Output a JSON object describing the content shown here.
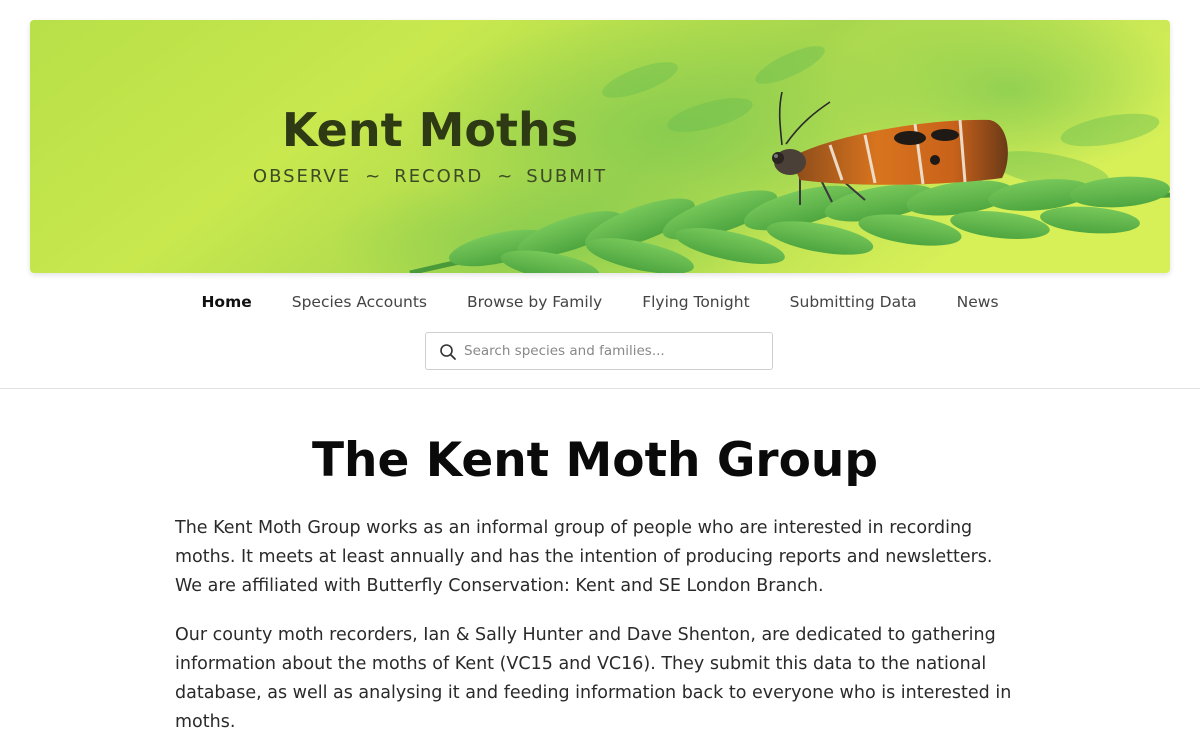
{
  "site": {
    "title": "Kent Moths",
    "tagline": [
      "OBSERVE",
      "RECORD",
      "SUBMIT"
    ],
    "tagline_separator": "~"
  },
  "nav": {
    "items": [
      {
        "label": "Home",
        "active": true
      },
      {
        "label": "Species Accounts",
        "active": false
      },
      {
        "label": "Browse by Family",
        "active": false
      },
      {
        "label": "Flying Tonight",
        "active": false
      },
      {
        "label": "Submitting Data",
        "active": false
      },
      {
        "label": "News",
        "active": false
      }
    ]
  },
  "search": {
    "placeholder": "Search species and families...",
    "value": "",
    "icon": "search-icon"
  },
  "main": {
    "heading": "The Kent Moth Group",
    "paragraphs": [
      "The Kent Moth Group works as an informal group of people who are interested in recording moths. It meets at least annually and has the intention of producing reports and newsletters. We are affiliated with Butterfly Conservation: Kent and SE London Branch.",
      "Our county moth recorders, Ian & Sally Hunter and Dave Shenton, are dedicated to gathering information about the moths of Kent (VC15 and VC16). They submit this data to the national database, as well as analysing it and feeding information back to everyone who is interested in moths."
    ]
  },
  "colors": {
    "banner_green_light": "#d9ef5c",
    "banner_green_mid": "#a9d94a",
    "fern_green": "#5fb64a",
    "title_dark_green": "#2e3a14",
    "moth_orange": "#d8741e"
  }
}
